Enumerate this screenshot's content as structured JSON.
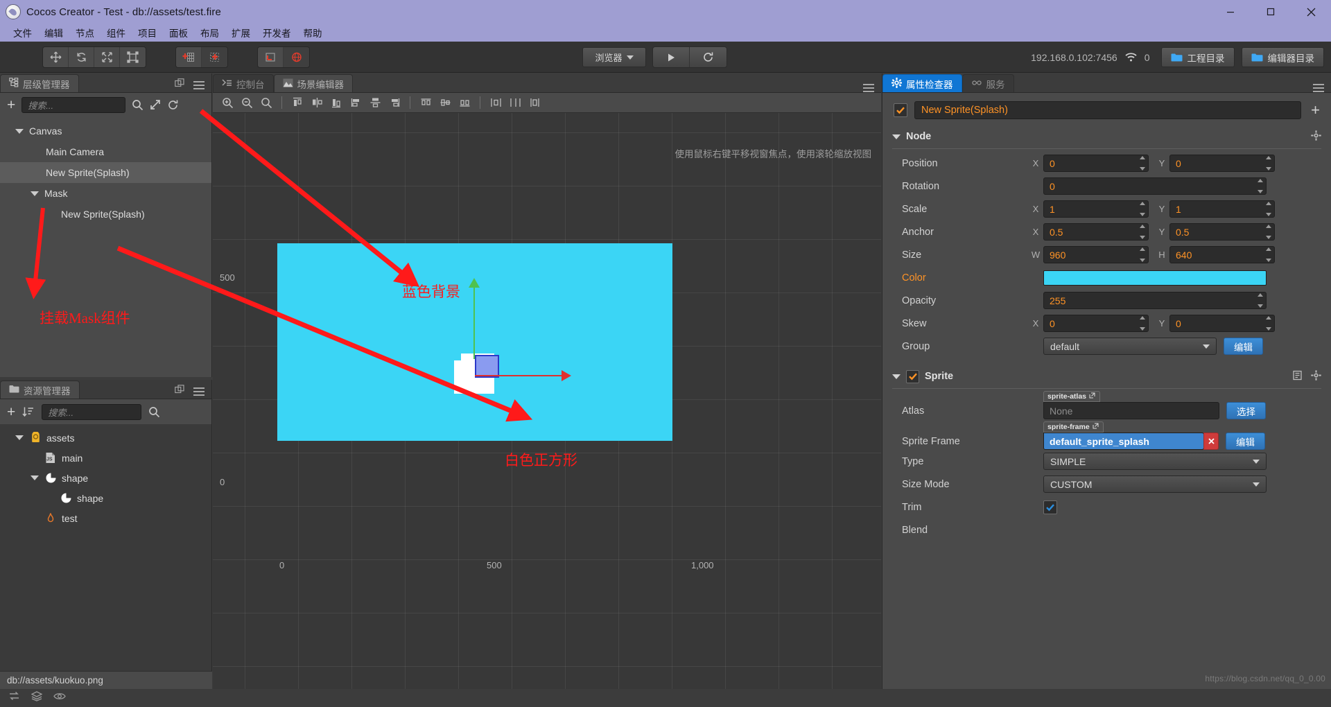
{
  "window": {
    "title": "Cocos Creator - Test - db://assets/test.fire",
    "minimize": "—",
    "maximize": "□",
    "close": "✕"
  },
  "menubar": {
    "items": [
      "文件",
      "编辑",
      "节点",
      "组件",
      "项目",
      "面板",
      "布局",
      "扩展",
      "开发者",
      "帮助"
    ]
  },
  "toolbar": {
    "transform_tools": [
      "move-tool",
      "rotate-tool",
      "scale-tool",
      "rect-tool"
    ],
    "pivot_tools": [
      "pivot-center-tool",
      "pivot-node-tool"
    ],
    "coord_tools": [
      "local-coord-tool",
      "global-coord-tool"
    ],
    "preview_target": "浏览器",
    "play_label": "play-icon",
    "refresh_label": "refresh-icon",
    "ip_address": "192.168.0.102:7456",
    "connection_count": "0",
    "project_dir_button": "工程目录",
    "editor_dir_button": "编辑器目录"
  },
  "hierarchy": {
    "tab_title": "层级管理器",
    "search_placeholder": "搜索...",
    "nodes": [
      {
        "label": "Canvas",
        "depth": 0,
        "expandable": true,
        "selected": false
      },
      {
        "label": "Main Camera",
        "depth": 1,
        "expandable": false,
        "selected": false
      },
      {
        "label": "New Sprite(Splash)",
        "depth": 1,
        "expandable": false,
        "selected": true
      },
      {
        "label": "Mask",
        "depth": 1,
        "expandable": true,
        "selected": false
      },
      {
        "label": "New Sprite(Splash)",
        "depth": 2,
        "expandable": false,
        "selected": false
      }
    ]
  },
  "assets": {
    "tab_title": "资源管理器",
    "search_placeholder": "搜索...",
    "nodes": [
      {
        "label": "assets",
        "depth": 0,
        "expandable": true,
        "icon": "assets-folder-icon"
      },
      {
        "label": "main",
        "depth": 1,
        "expandable": false,
        "icon": "js-file-icon"
      },
      {
        "label": "shape",
        "depth": 1,
        "expandable": true,
        "icon": "texture-icon"
      },
      {
        "label": "shape",
        "depth": 2,
        "expandable": false,
        "icon": "sprite-frame-icon"
      },
      {
        "label": "test",
        "depth": 1,
        "expandable": false,
        "icon": "fire-scene-icon"
      }
    ],
    "status_path": "db://assets/kuokuo.png"
  },
  "center": {
    "tabs": [
      {
        "label": "控制台",
        "icon": "console-icon",
        "active": false
      },
      {
        "label": "场景编辑器",
        "icon": "scene-icon",
        "active": true
      }
    ],
    "hint": "使用鼠标右键平移视窗焦点，使用滚轮缩放视图",
    "ruler": {
      "y_500": "500",
      "y_0": "0",
      "x_0": "0",
      "x_500": "500",
      "x_1000": "1,000"
    }
  },
  "annotations": [
    {
      "id": "mask-note",
      "text": "挂载Mask组件",
      "color": "#ff1a1a"
    },
    {
      "id": "blue-bg-note",
      "text": "蓝色背景",
      "color": "#ff1a1a"
    },
    {
      "id": "white-square-note",
      "text": "白色正方形",
      "color": "#ff1a1a"
    }
  ],
  "inspector": {
    "tabs": [
      {
        "label": "属性检查器",
        "icon": "gear-icon",
        "active": true
      },
      {
        "label": "服务",
        "icon": "services-icon",
        "active": false
      }
    ],
    "node_name": "New Sprite(Splash)",
    "node_section": {
      "title": "Node",
      "position": {
        "label": "Position",
        "x_axis": "X",
        "x": "0",
        "y_axis": "Y",
        "y": "0"
      },
      "rotation": {
        "label": "Rotation",
        "value": "0"
      },
      "scale": {
        "label": "Scale",
        "x_axis": "X",
        "x": "1",
        "y_axis": "Y",
        "y": "1"
      },
      "anchor": {
        "label": "Anchor",
        "x_axis": "X",
        "x": "0.5",
        "y_axis": "Y",
        "y": "0.5"
      },
      "size": {
        "label": "Size",
        "w_axis": "W",
        "w": "960",
        "h_axis": "H",
        "h": "640"
      },
      "color": {
        "label": "Color",
        "value": "#3bd5f5"
      },
      "opacity": {
        "label": "Opacity",
        "value": "255"
      },
      "skew": {
        "label": "Skew",
        "x_axis": "X",
        "x": "0",
        "y_axis": "Y",
        "y": "0"
      },
      "group": {
        "label": "Group",
        "value": "default",
        "edit_button": "编辑"
      }
    },
    "sprite_section": {
      "title": "Sprite",
      "atlas": {
        "label": "Atlas",
        "tag": "sprite-atlas",
        "value": "None",
        "button": "选择"
      },
      "sprite_frame": {
        "label": "Sprite Frame",
        "tag": "sprite-frame",
        "value": "default_sprite_splash",
        "button": "编辑"
      },
      "type": {
        "label": "Type",
        "value": "SIMPLE"
      },
      "size_mode": {
        "label": "Size Mode",
        "value": "CUSTOM"
      },
      "trim": {
        "label": "Trim",
        "checked": true
      },
      "blend": {
        "label": "Blend"
      }
    }
  },
  "footer": {
    "watermark": "https://blog.csdn.net/qq_0_0.00"
  },
  "colors": {
    "accent_orange": "#ff9326",
    "canvas_blue": "#3bd5f5",
    "annotation_red": "#ff1a1a",
    "tab_blue": "#1076d4",
    "titlebar_purple": "#9f9ed2"
  }
}
